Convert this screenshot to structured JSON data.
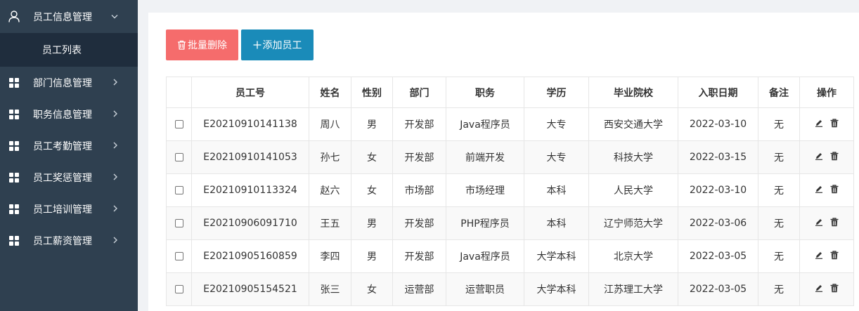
{
  "sidebar": {
    "groups": [
      {
        "label": "员工信息管理",
        "icon": "user-icon",
        "expanded": true,
        "children": [
          "员工列表"
        ]
      },
      {
        "label": "部门信息管理",
        "icon": "grid-icon"
      },
      {
        "label": "职务信息管理",
        "icon": "grid-icon"
      },
      {
        "label": "员工考勤管理",
        "icon": "grid-icon"
      },
      {
        "label": "员工奖惩管理",
        "icon": "grid-icon"
      },
      {
        "label": "员工培训管理",
        "icon": "grid-icon"
      },
      {
        "label": "员工薪资管理",
        "icon": "grid-icon"
      }
    ]
  },
  "toolbar": {
    "batch_delete_label": "批量删除",
    "add_label": "添加员工"
  },
  "table": {
    "headers": [
      "员工号",
      "姓名",
      "性别",
      "部门",
      "职务",
      "学历",
      "毕业院校",
      "入职日期",
      "备注",
      "操作"
    ],
    "rows": [
      [
        "E20210910141138",
        "周八",
        "男",
        "开发部",
        "Java程序员",
        "大专",
        "西安交通大学",
        "2022-03-10",
        "无"
      ],
      [
        "E20210910141053",
        "孙七",
        "女",
        "开发部",
        "前端开发",
        "大专",
        "科技大学",
        "2022-03-15",
        "无"
      ],
      [
        "E20210910113324",
        "赵六",
        "女",
        "市场部",
        "市场经理",
        "本科",
        "人民大学",
        "2022-03-10",
        "无"
      ],
      [
        "E20210906091710",
        "王五",
        "男",
        "开发部",
        "PHP程序员",
        "本科",
        "辽宁师范大学",
        "2022-03-06",
        "无"
      ],
      [
        "E20210905160859",
        "李四",
        "男",
        "开发部",
        "Java程序员",
        "大学本科",
        "北京大学",
        "2022-03-05",
        "无"
      ],
      [
        "E20210905154521",
        "张三",
        "女",
        "运营部",
        "运营职员",
        "大学本科",
        "江苏理工大学",
        "2022-03-05",
        "无"
      ]
    ]
  },
  "colors": {
    "sidebar_bg": "#2f4050",
    "submenu_bg": "#1f2d3d",
    "danger": "#f56c6c",
    "primary": "#1a8bb9"
  }
}
